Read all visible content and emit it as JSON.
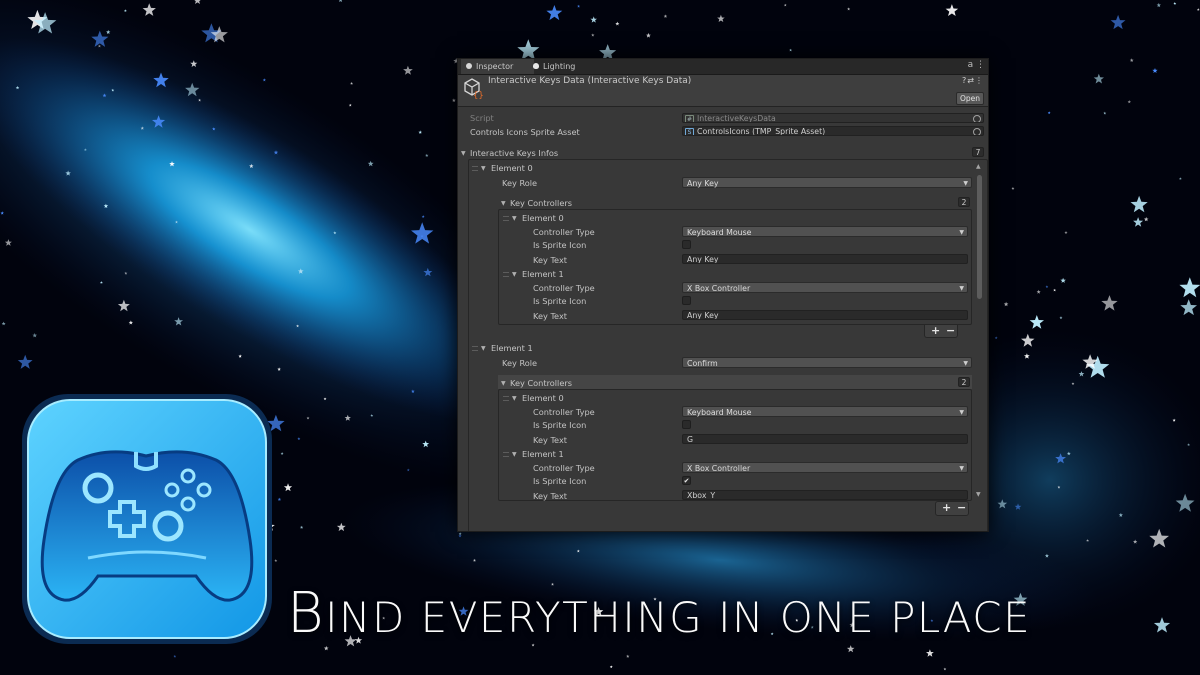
{
  "tabs": [
    {
      "label": "Inspector",
      "icon": "info-icon",
      "active": true
    },
    {
      "label": "Lighting",
      "icon": "lightbulb-icon",
      "active": false
    }
  ],
  "header": {
    "title": "Interactive Keys Data (Interactive Keys Data)",
    "open_label": "Open",
    "icons": [
      "help-icon",
      "preset-icon",
      "more-icon"
    ]
  },
  "script_field": {
    "label": "Script",
    "value": "InteractiveKeysData"
  },
  "sprite_asset_field": {
    "label": "Controls Icons Sprite Asset",
    "value": "ControlsIcons (TMP_Sprite Asset)"
  },
  "list": {
    "label": "Interactive Keys Infos",
    "count": "7",
    "elements": [
      {
        "label": "Element 0",
        "key_role_label": "Key Role",
        "key_role": "Any Key",
        "controllers_label": "Key Controllers",
        "controllers_count": "2",
        "controllers": [
          {
            "label": "Element 0",
            "type_label": "Controller Type",
            "type": "Keyboard Mouse",
            "sprite_label": "Is Sprite Icon",
            "is_sprite": false,
            "text_label": "Key Text",
            "text": "Any Key"
          },
          {
            "label": "Element 1",
            "type_label": "Controller Type",
            "type": "X Box Controller",
            "sprite_label": "Is Sprite Icon",
            "is_sprite": false,
            "text_label": "Key Text",
            "text": "Any Key"
          }
        ]
      },
      {
        "label": "Element 1",
        "key_role_label": "Key Role",
        "key_role": "Confirm",
        "controllers_label": "Key Controllers",
        "controllers_count": "2",
        "controllers": [
          {
            "label": "Element 0",
            "type_label": "Controller Type",
            "type": "Keyboard Mouse",
            "sprite_label": "Is Sprite Icon",
            "is_sprite": false,
            "text_label": "Key Text",
            "text": "G"
          },
          {
            "label": "Element 1",
            "type_label": "Controller Type",
            "type": "X Box Controller",
            "sprite_label": "Is Sprite Icon",
            "is_sprite": true,
            "text_label": "Key Text",
            "text": "Xbox_Y"
          }
        ]
      }
    ]
  },
  "buttons": {
    "plus": "+",
    "minus": "−"
  },
  "checkmark": "✔",
  "tagline": {
    "cap": "B",
    "rest": "ind everything in one place"
  },
  "colors": {
    "panel": "#383838",
    "background": "#01030d",
    "glow": "#1fb8ff",
    "logo_blue": "#29b6f6"
  }
}
